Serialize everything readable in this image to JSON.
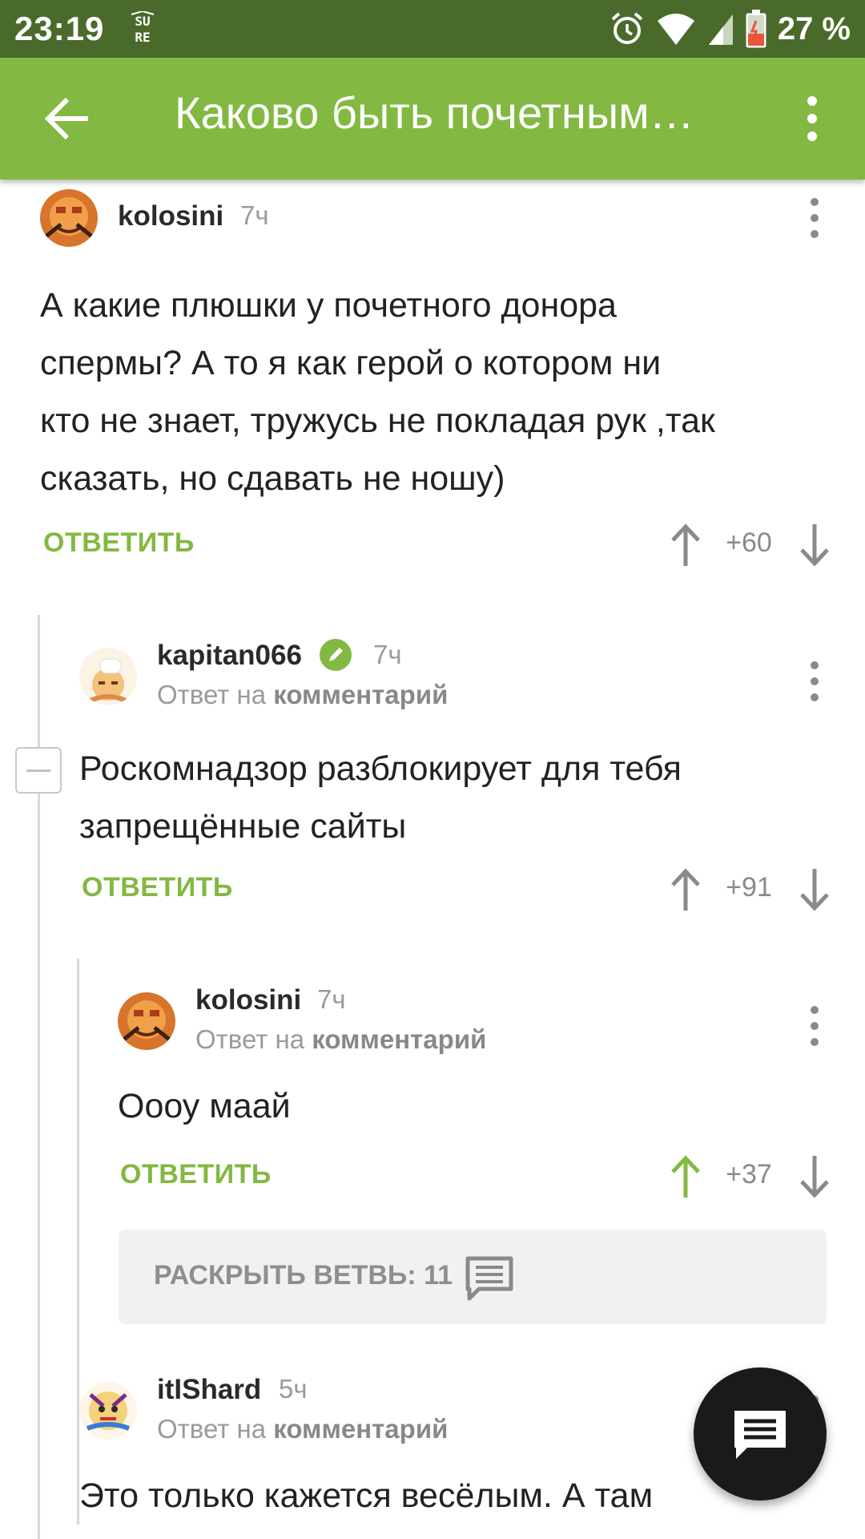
{
  "status_bar": {
    "time": "23:19",
    "battery_percent": "27 %",
    "icons": [
      "sure-icon",
      "alarm-icon",
      "wifi-icon",
      "signal-icon",
      "battery-icon"
    ]
  },
  "app_bar": {
    "title": "Каково быть почетным…",
    "icons": [
      "back-arrow-icon",
      "more-vert-icon"
    ]
  },
  "comments": [
    {
      "user": "kolosini",
      "time": "7ч",
      "text": [
        "А какие плюшки у почетного донора",
        "спермы? А то я как герой о котором ни",
        "кто не знает, тружусь не покладая рук ,так",
        "сказать, но сдавать не ношу)"
      ],
      "reply_label": "ОТВЕТИТЬ",
      "score": "+60",
      "upvoted": false
    },
    {
      "user": "kapitan066",
      "time": "7ч",
      "verified": true,
      "reply_to_prefix": "Ответ на",
      "reply_to_link": "комментарий",
      "text": [
        "Роскомнадзор разблокирует для тебя",
        "запрещённые сайты"
      ],
      "reply_label": "ОТВЕТИТЬ",
      "score": "+91",
      "upvoted": false
    },
    {
      "user": "kolosini",
      "time": "7ч",
      "reply_to_prefix": "Ответ на",
      "reply_to_link": "комментарий",
      "text": [
        "Оооу маай"
      ],
      "reply_label": "ОТВЕТИТЬ",
      "score": "+37",
      "upvoted": true
    },
    {
      "user": "itIShard",
      "time": "5ч",
      "reply_to_prefix": "Ответ на",
      "reply_to_link": "комментарий",
      "text": [
        "Это только кажется весёлым. А там"
      ]
    }
  ],
  "expand_branch": {
    "label": "РАСКРЫТЬ ВЕТВЬ: 11"
  },
  "colors": {
    "accent": "#83b842",
    "status_bar": "#4a6a2c",
    "text": "#222222",
    "muted": "#9a9a9a",
    "upvote_active": "#83b842"
  }
}
